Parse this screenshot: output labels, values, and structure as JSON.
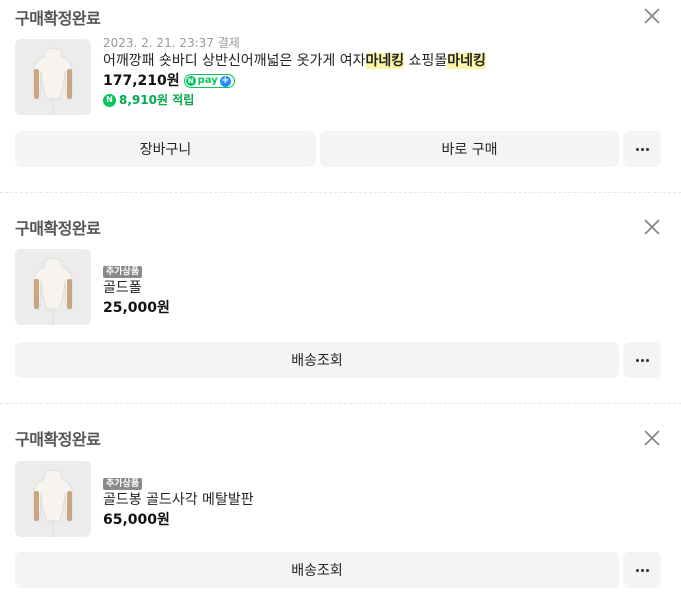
{
  "orders": [
    {
      "status": "구매확정완료",
      "close_icon": "close-icon",
      "date": "2023. 2. 21. 23:37 결제",
      "title_parts": [
        "어깨깡패 숏바디 상반신어깨넓은 옷가게 여자",
        "마네킹",
        " 쇼핑몰",
        "마네킹"
      ],
      "price": "177,210원",
      "npay_label": "pay",
      "npay_n": "N",
      "npay_plus": "+",
      "points_coin": "N",
      "points": "8,910원 적립",
      "buttons": [
        "장바구니",
        "바로 구매"
      ]
    },
    {
      "status": "구매확정완료",
      "close_icon": "close-icon",
      "badge": "추가상품",
      "name": "골드폴",
      "price": "25,000원",
      "buttons": [
        "배송조회"
      ]
    },
    {
      "status": "구매확정완료",
      "close_icon": "close-icon",
      "badge": "추가상품",
      "name": "골드봉 골드사각 메탈발판",
      "price": "65,000원",
      "buttons": [
        "배송조회"
      ]
    }
  ]
}
